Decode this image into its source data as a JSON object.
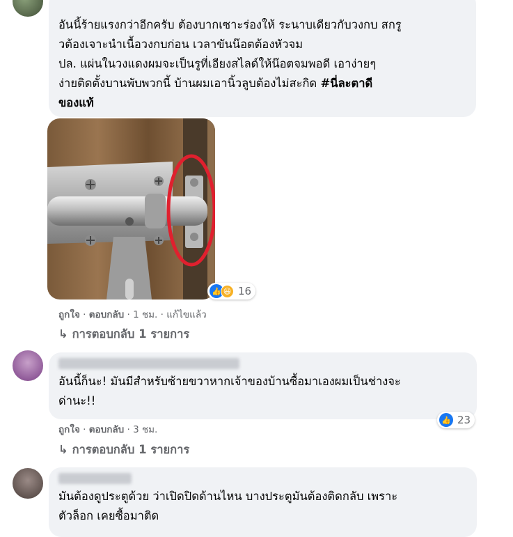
{
  "comments": [
    {
      "text_lines": [
        "อันนี้ร้ายแรงกว่าอีกครับ ต้องบากเซาะร่องให้ ระนาบเดียวกับวงกบ สกรู",
        "วต้องเจาะนำเนื้อวงกบก่อน เวลาขันน๊อตต้องหัวจม",
        "ปล. แผ่นในวงแดงผมจะเป็นรูที่เอียงสไลด์ให้น๊อตจมพอดี เอาง่ายๆ",
        "ง่ายติดตั้งบานพับพวกนี้ บ้านผมเอานิ้วลูบต้องไม่สะกิด "
      ],
      "hashtag_part1": "#นี่ละตาดี",
      "hashtag_part2": "ของแท้",
      "reaction_count": "16",
      "actions": {
        "like": "ถูกใจ",
        "reply": "ตอบกลับ",
        "time": "1 ชม.",
        "edited": "แก้ไขแล้ว"
      },
      "replies_label": "การตอบกลับ 1 รายการ"
    },
    {
      "text_lines": [
        "อันนี้ก็นะ! มันมีสำหรับซ้ายขวาหากเจ้าของบ้านซื้อมาเองผมเป็นช่างจะ",
        "ด่านะ!!"
      ],
      "reaction_count": "23",
      "actions": {
        "like": "ถูกใจ",
        "reply": "ตอบกลับ",
        "time": "3 ชม."
      },
      "replies_label": "การตอบกลับ 1 รายการ"
    },
    {
      "text_lines": [
        "มันต้องดูประตูด้วย ว่าเปิดปิดด้านไหน บางประตูมันต้องติดกลับ เพราะ",
        "ตัวล็อก เคยซื้อมาติด"
      ]
    }
  ],
  "separator": "·",
  "reply_arrow": "↳",
  "colors": {
    "bubble": "#f0f2f5",
    "meta": "#65676b",
    "like_blue": "#1877f2",
    "circle_red": "#e0202e"
  },
  "icons": [
    "like-icon",
    "haha-icon",
    "reply-arrow-icon"
  ]
}
